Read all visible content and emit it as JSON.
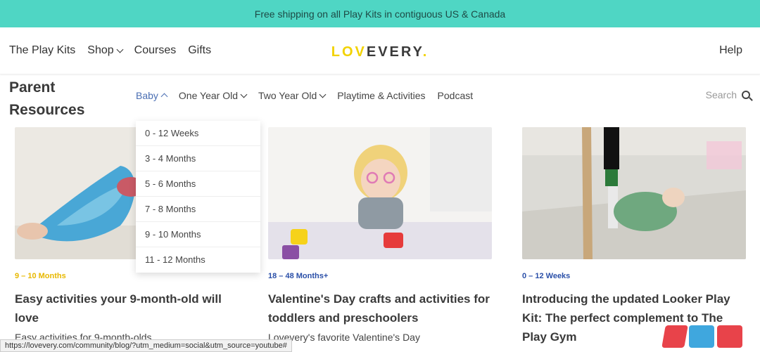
{
  "promo": {
    "text": "Free shipping on all Play Kits in contiguous US & Canada"
  },
  "topnav": {
    "play_kits": "The Play Kits",
    "shop": "Shop",
    "courses": "Courses",
    "gifts": "Gifts",
    "logo_a": "LOV",
    "logo_b": "EVERY",
    "logo_dot": ".",
    "help": "Help"
  },
  "subnav": {
    "title": "Parent Resources",
    "baby": "Baby",
    "one_year": "One Year Old",
    "two_year": "Two Year Old",
    "playtime": "Playtime & Activities",
    "podcast": "Podcast",
    "search": "Search"
  },
  "dropdown": {
    "items": [
      "0 - 12 Weeks",
      "3 - 4 Months",
      "5 - 6 Months",
      "7 - 8 Months",
      "9 - 10 Months",
      "11 - 12 Months"
    ]
  },
  "cards": [
    {
      "tag": "9 – 10 Months",
      "tag_color": "#e8b800",
      "headline": "Easy activities your 9-month-old will love",
      "excerpt": "Easy activities for 9-month-olds"
    },
    {
      "tag": "18 – 48 Months+",
      "tag_color": "#2a4fa8",
      "headline": "Valentine's Day crafts and activities for toddlers and preschoolers",
      "excerpt": "Lovevery's favorite Valentine's Day"
    },
    {
      "tag": "0 – 12 Weeks",
      "tag_color": "#2a4fa8",
      "headline": "Introducing the updated Looker Play Kit: The perfect complement to The Play Gym",
      "excerpt": ""
    }
  ],
  "statusbar": {
    "url": "https://lovevery.com/community/blog/?utm_medium=social&utm_source=youtube#"
  },
  "colors": {
    "promo_bg": "#4fd6c4",
    "accent_blue": "#4b6fb3",
    "logo_yellow": "#f2d200"
  }
}
